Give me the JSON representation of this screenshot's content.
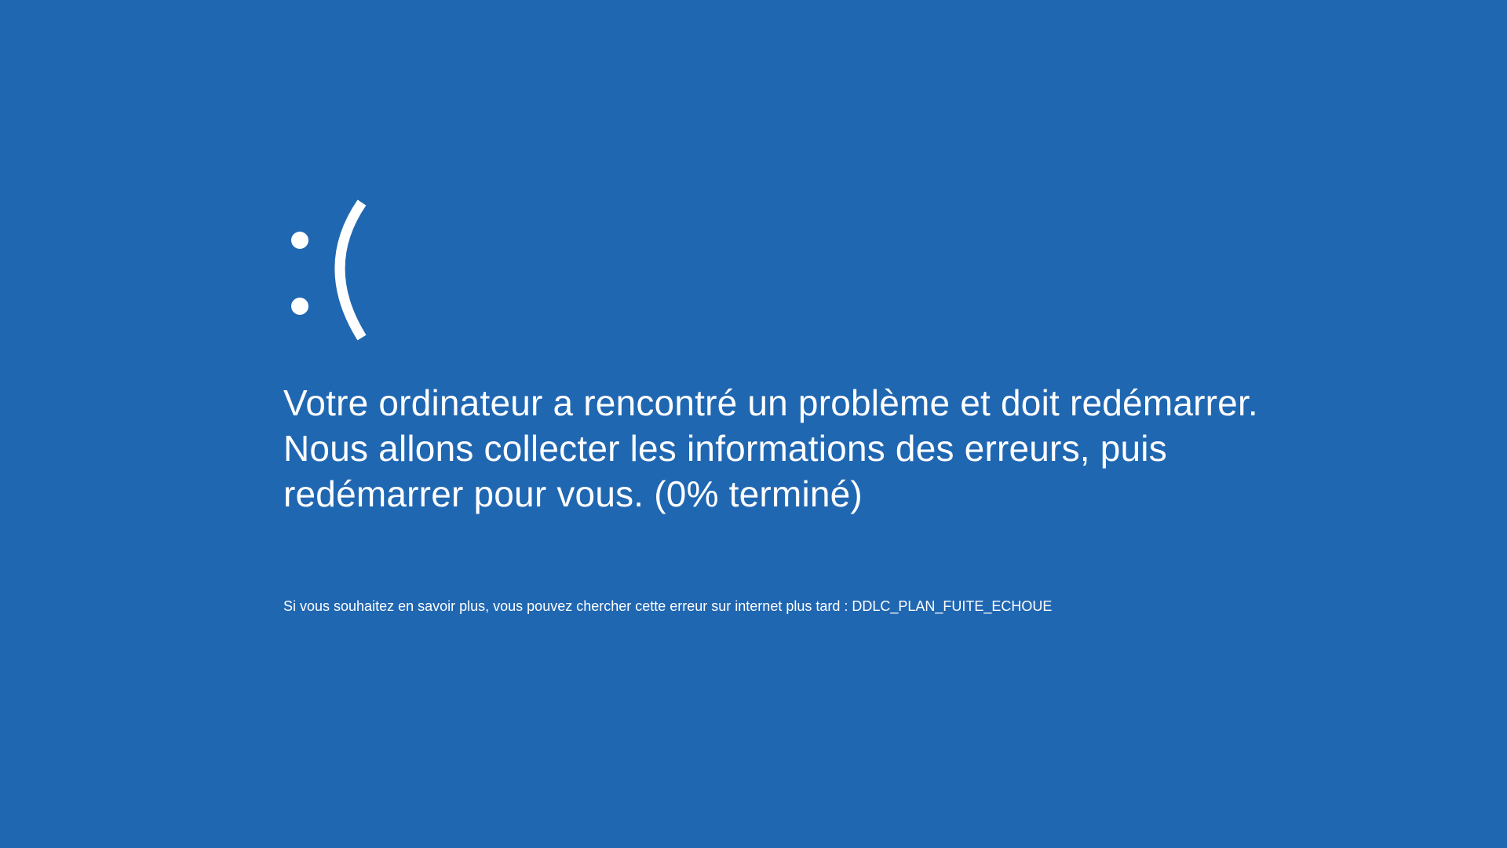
{
  "screen": {
    "background_color": "#2067b2",
    "text_color": "#ffffff"
  },
  "face": {
    "icon": "sad-face-icon",
    "text": ":("
  },
  "message": {
    "lines": [
      "Votre ordinateur a rencontré un problème et doit redémarrer.",
      "Nous allons collecter les informations des erreurs, puis",
      "redémarrer pour vous. (0% terminé)"
    ],
    "progress_percent": 0
  },
  "info": {
    "text": "Si vous souhaitez en savoir plus, vous pouvez chercher cette erreur sur internet plus tard : DDLC_PLAN_FUITE_ECHOUE"
  }
}
